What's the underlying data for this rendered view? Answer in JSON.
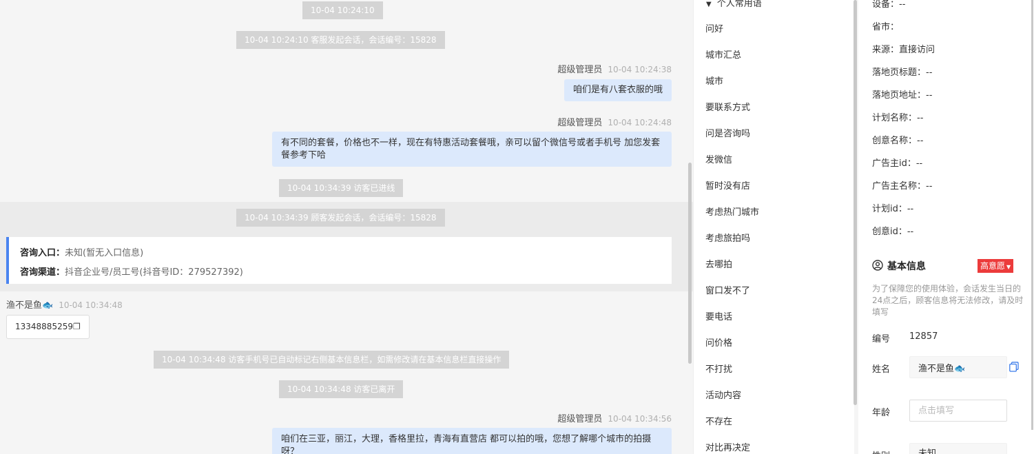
{
  "chat": {
    "sys1": "10-04 10:24:10",
    "sys2": "10-04 10:24:10 客服发起会话，会话编号：15828",
    "msg1": {
      "sender": "超级管理员",
      "time": "10-04 10:24:38",
      "text": "咱们是有八套衣服的哦"
    },
    "msg2": {
      "sender": "超级管理员",
      "time": "10-04 10:24:48",
      "line1": "有不同的套餐，价格也不一样，现在有特惠活动套餐哦，亲可以留个微信号或者手机号 加您发套",
      "line2": "餐参考下哈"
    },
    "sys3": "10-04 10:34:39 访客已进线",
    "sys4": "10-04 10:34:39 顾客发起会话，会话编号：15828",
    "entry": {
      "label1": "咨询入口：",
      "value1": "未知(暂无入口信息)",
      "label2": "咨询渠道：",
      "value2": "抖音企业号/员工号(抖音号ID：279527392)"
    },
    "visitor": {
      "name": "渔不是鱼🐟",
      "time": "10-04 10:34:48",
      "phone": "13348885259"
    },
    "sys5": "10-04 10:34:48 访客手机号已自动标记右侧基本信息栏，如需修改请在基本信息栏直接操作",
    "sys6": "10-04 10:34:48 访客已离开",
    "msg3": {
      "sender": "超级管理员",
      "time": "10-04 10:34:56",
      "line1": "咱们在三亚，丽江，大理，香格里拉，青海有直营店 都可以拍的哦，您想了解哪个城市的拍摄",
      "line2": "呀？"
    }
  },
  "phrases": {
    "header": "个人常用语",
    "items": [
      "问好",
      "城市汇总",
      "城市",
      "要联系方式",
      "问是咨询吗",
      "发微信",
      "暂时没有店",
      "考虑热门城市",
      "考虑旅拍吗",
      "去哪拍",
      "窗口发不了",
      "要电话",
      "问价格",
      "不打扰",
      "活动内容",
      "不存在",
      "对比再决定"
    ]
  },
  "info": {
    "device": "设备：--",
    "province": "省市：",
    "source": "来源：直接访问",
    "landing_title": "落地页标题：--",
    "landing_url": "落地页地址：--",
    "plan_name": "计划名称：--",
    "creative_name": "创意名称：--",
    "advertiser_id": "广告主id：--",
    "advertiser_name": "广告主名称：--",
    "plan_id": "计划id：--",
    "creative_id": "创意id：--",
    "basic_title": "基本信息",
    "intent_badge": "高意愿",
    "notice": "为了保障您的使用体验，会话发生当日的24点之后，顾客信息将无法修改，请及时填写",
    "number_label": "编号",
    "number_value": "12857",
    "name_label": "姓名",
    "name_value": "渔不是鱼🐟",
    "age_label": "年龄",
    "age_placeholder": "点击填写",
    "gender_label": "性别",
    "gender_value": "未知"
  }
}
